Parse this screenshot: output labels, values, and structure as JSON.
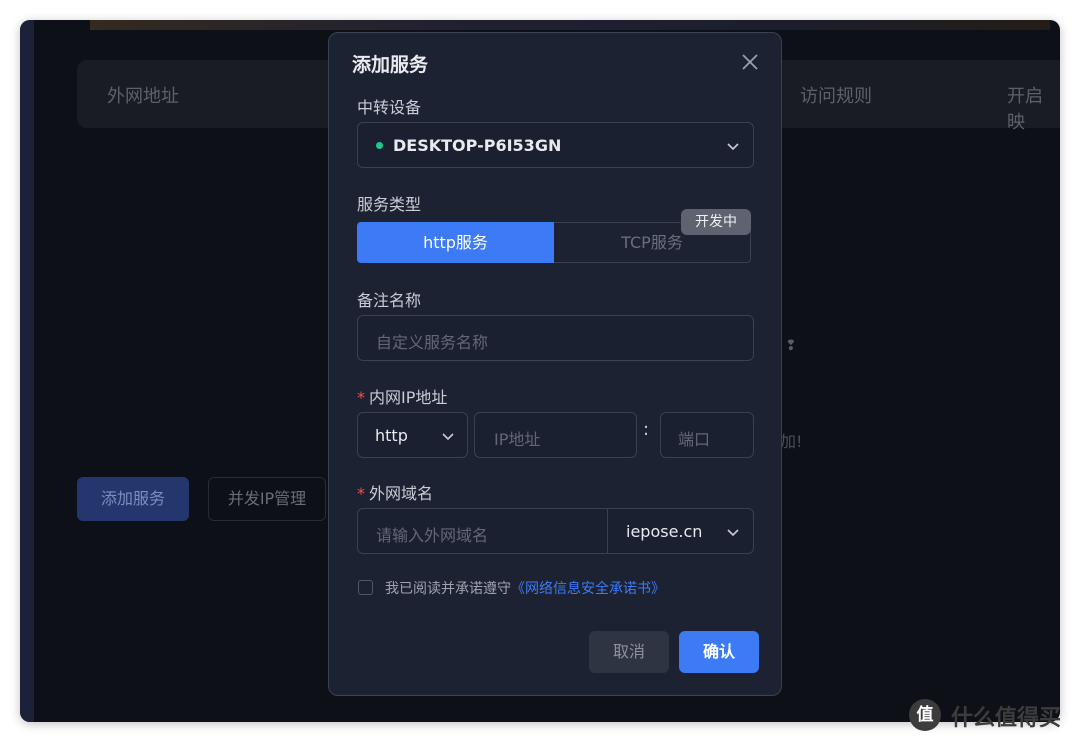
{
  "background": {
    "columns": [
      "外网地址",
      "访问规则",
      "开启映"
    ],
    "add_service_button": "添加服务",
    "concurrent_ip_button": "并发IP管理",
    "empty_hint": "加!"
  },
  "modal": {
    "title": "添加服务",
    "relay_device": {
      "label": "中转设备",
      "value": "DESKTOP-P6I53GN",
      "status_color": "#1fc98a"
    },
    "service_type": {
      "label": "服务类型",
      "options": [
        "http服务",
        "TCP服务"
      ],
      "selected": "http服务",
      "badge": "开发中"
    },
    "remark_name": {
      "label": "备注名称",
      "placeholder": "自定义服务名称"
    },
    "lan_ip": {
      "required_mark": "*",
      "label": "内网IP地址",
      "protocol": "http",
      "ip_placeholder": "IP地址",
      "separator": ":",
      "port_placeholder": "端口"
    },
    "domain": {
      "required_mark": "*",
      "label": "外网域名",
      "placeholder": "请输入外网域名",
      "suffix": "iepose.cn"
    },
    "agreement": {
      "text": "我已阅读并承诺遵守",
      "link": "《网络信息安全承诺书》"
    },
    "buttons": {
      "cancel": "取消",
      "confirm": "确认"
    },
    "accent_color": "#3d7af5"
  },
  "watermark": {
    "icon_char": "值",
    "text": "什么值得买"
  }
}
